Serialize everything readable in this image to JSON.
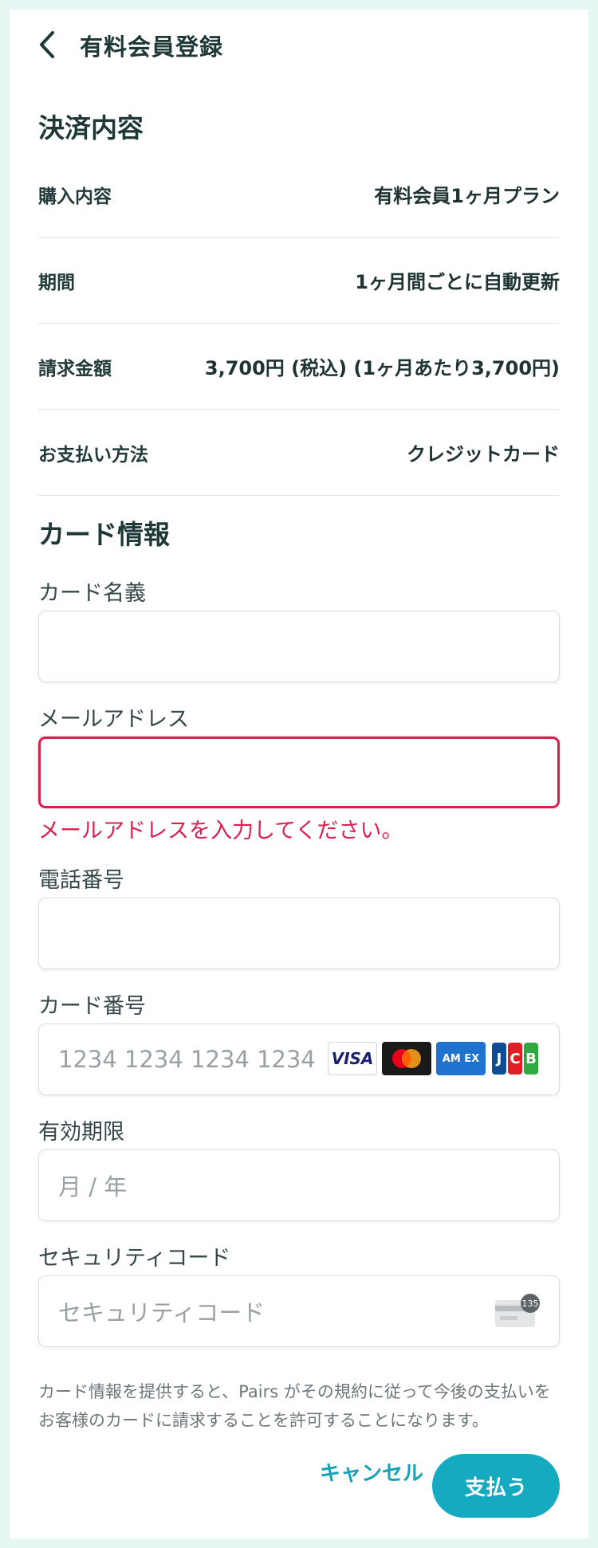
{
  "header": {
    "title": "有料会員登録"
  },
  "payment": {
    "section_title": "決済内容",
    "rows": [
      {
        "label": "購入内容",
        "value": "有料会員1ヶ月プラン"
      },
      {
        "label": "期間",
        "value": "1ヶ月間ごとに自動更新"
      },
      {
        "label": "請求金額",
        "value": "3,700円 (税込) (1ヶ月あたり3,700円)"
      },
      {
        "label": "お支払い方法",
        "value": "クレジットカード"
      }
    ]
  },
  "card": {
    "section_title": "カード情報",
    "name_label": "カード名義",
    "name_value": "",
    "email_label": "メールアドレス",
    "email_value": "",
    "email_error": "メールアドレスを入力してください。",
    "phone_label": "電話番号",
    "phone_value": "",
    "number_label": "カード番号",
    "number_placeholder": "1234 1234 1234 1234",
    "brands": [
      "visa-logo",
      "mastercard-logo",
      "amex-logo",
      "jcb-logo"
    ],
    "visa_text": "VISA",
    "amex_text": "AM EX",
    "jcb_letters": [
      "J",
      "C",
      "B"
    ],
    "expiry_label": "有効期限",
    "expiry_placeholder": "月 / 年",
    "cvc_label": "セキュリティコード",
    "cvc_placeholder": "セキュリティコード",
    "cvc_icon_text": "135"
  },
  "legal": "カード情報を提供すると、Pairs がその規約に従って今後の支払いをお客様のカードに請求することを許可することになります。",
  "actions": {
    "cancel_label": "キャンセル",
    "pay_label": "支払う"
  },
  "colors": {
    "accent": "#14aac0",
    "error": "#d8214f",
    "background": "#e6f6f2"
  }
}
